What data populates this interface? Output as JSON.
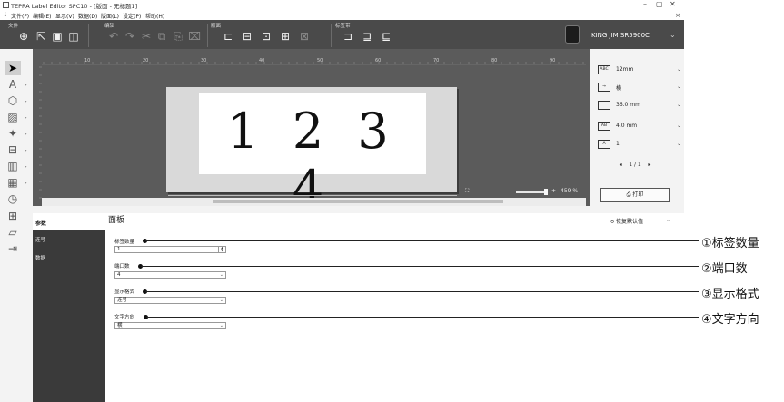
{
  "window": {
    "title": "TEPRA Label Editor SPC10 - [版面 - 无标题1]",
    "controls": [
      "–",
      "▢",
      "✕"
    ]
  },
  "menu": {
    "quick_access": "⇣",
    "items": [
      "文件(F)",
      "编辑(E)",
      "显示(V)",
      "数据(D)",
      "版面(L)",
      "设定(P)",
      "帮助(H)"
    ],
    "close": "×"
  },
  "ribbon": {
    "groups": [
      "文件",
      "编辑",
      "版面",
      "标签带"
    ],
    "printer": "KING JIM SR5900C"
  },
  "canvas": {
    "label_text": "1 2 3 4",
    "ruler_marks": [
      "10",
      "20",
      "30",
      "40",
      "50",
      "60",
      "70",
      "80",
      "90"
    ],
    "zoom_text": "459 %"
  },
  "properties": [
    {
      "icon": "tape-width-icon",
      "icon_text": "ABC",
      "value": "12mm"
    },
    {
      "icon": "text-direction-icon",
      "icon_text": "→",
      "value": "横"
    },
    {
      "icon": "length-icon",
      "icon_text": "",
      "value": "36.0 mm"
    },
    {
      "icon": "margin-icon",
      "icon_text": "AB",
      "value": "4.0 mm"
    },
    {
      "icon": "copies-icon",
      "icon_text": "A",
      "value": "1"
    }
  ],
  "pager": {
    "text": "1 / 1"
  },
  "print_button": {
    "label": "打印"
  },
  "panel": {
    "side_header": "参数",
    "side_items": [
      "连号",
      "数据"
    ],
    "title": "面板",
    "reset_label": "恢复默认值",
    "fields": [
      {
        "label": "标签数量",
        "value": "1"
      },
      {
        "label": "端口数",
        "value": "4"
      },
      {
        "label": "显示格式",
        "value": "连号"
      },
      {
        "label": "文字方向",
        "value": "横"
      }
    ]
  },
  "callouts": [
    "①标签数量",
    "②端口数",
    "③显示格式",
    "④文字方向"
  ]
}
